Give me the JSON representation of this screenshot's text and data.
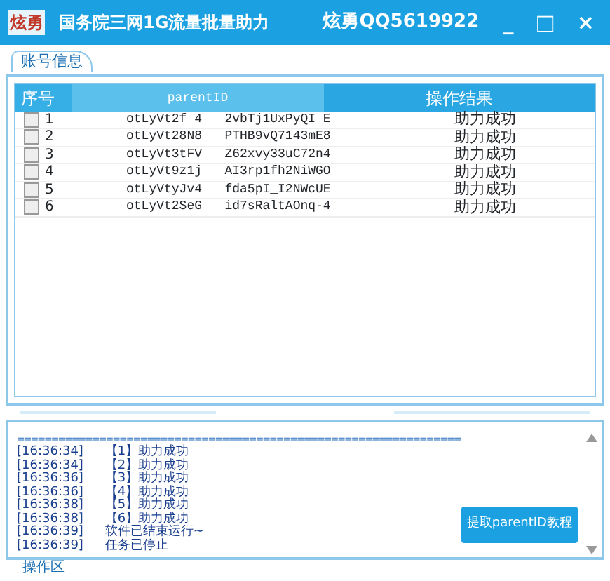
{
  "window": {
    "logo": "炫勇",
    "title": "国务院三网1G流量批量助力",
    "author": "炫勇QQ5619922",
    "controls": [
      "_",
      "□",
      "×"
    ]
  },
  "tabs": [
    {
      "label": "账号信息",
      "selected": true
    }
  ],
  "table": {
    "columns": [
      "序号",
      "parentID",
      "操作结果"
    ],
    "rows": [
      {
        "checked": false,
        "index": "1",
        "id": "otLyVt2f_4   2vbTj1UxPyQI_E",
        "result": "助力成功"
      },
      {
        "checked": false,
        "index": "2",
        "id": "otLyVt28N8   PTHB9vQ7143mE8",
        "result": "助力成功"
      },
      {
        "checked": false,
        "index": "3",
        "id": "otLyVt3tFV   Z62xvy33uC72n4",
        "result": "助力成功"
      },
      {
        "checked": false,
        "index": "4",
        "id": "otLyVt9z1j   AI3rp1fh2NiWGO",
        "result": "助力成功"
      },
      {
        "checked": false,
        "index": "5",
        "id": "otLyVtyJv4   fda5pI_I2NWcUE",
        "result": "助力成功"
      },
      {
        "checked": false,
        "index": "6",
        "id": "otLyVt2SeG   id7sRaltAOnq-4",
        "result": "助力成功"
      }
    ]
  },
  "log": {
    "separator": "=================================================================",
    "lines": [
      {
        "time": "[16:36:34]",
        "text": "【1】助力成功"
      },
      {
        "time": "[16:36:34]",
        "text": "【2】助力成功"
      },
      {
        "time": "[16:36:36]",
        "text": "【3】助力成功"
      },
      {
        "time": "[16:36:36]",
        "text": "【4】助力成功"
      },
      {
        "time": "[16:36:38]",
        "text": "【5】助力成功"
      },
      {
        "time": "[16:36:38]",
        "text": "【6】助力成功"
      },
      {
        "time": "[16:36:39]",
        "text": "软件已结束运行~"
      },
      {
        "time": "[16:36:39]",
        "text": "任务已停止"
      }
    ],
    "button": "提取parentID教程"
  },
  "footer_label": "操作区"
}
